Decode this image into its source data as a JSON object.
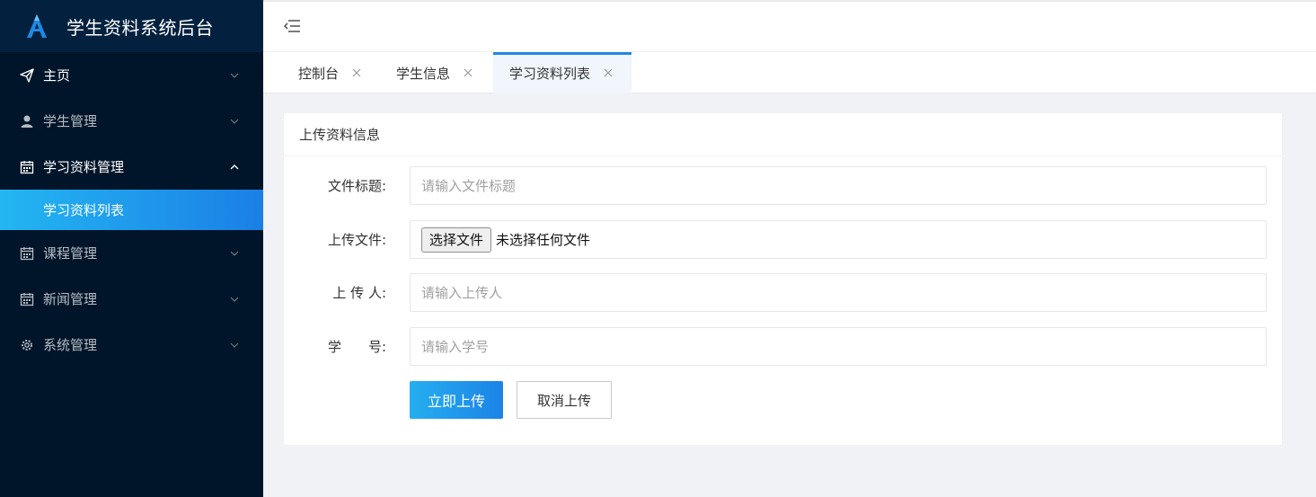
{
  "app": {
    "title": "学生资料系统后台"
  },
  "sidebar": {
    "items": [
      {
        "label": "主页",
        "icon": "send-icon",
        "expanded": false
      },
      {
        "label": "学生管理",
        "icon": "user-icon",
        "expanded": false
      },
      {
        "label": "学习资料管理",
        "icon": "calendar-icon",
        "expanded": true,
        "children": [
          {
            "label": "学习资料列表",
            "active": true
          }
        ]
      },
      {
        "label": "课程管理",
        "icon": "calendar-icon",
        "expanded": false
      },
      {
        "label": "新闻管理",
        "icon": "calendar-icon",
        "expanded": false
      },
      {
        "label": "系统管理",
        "icon": "gear-icon",
        "expanded": false
      }
    ]
  },
  "tabs": [
    {
      "label": "控制台",
      "active": false
    },
    {
      "label": "学生信息",
      "active": false
    },
    {
      "label": "学习资料列表",
      "active": true
    }
  ],
  "card": {
    "title": "上传资料信息",
    "fields": {
      "title": {
        "label": "文件标题:",
        "placeholder": "请输入文件标题",
        "value": ""
      },
      "file": {
        "label": "上传文件:",
        "button": "选择文件",
        "status": "未选择任何文件"
      },
      "uploader": {
        "label": "上 传 人:",
        "placeholder": "请输入上传人",
        "value": ""
      },
      "student_id": {
        "label": "学　　号:",
        "placeholder": "请输入学号",
        "value": ""
      }
    },
    "submit_label": "立即上传",
    "cancel_label": "取消上传"
  },
  "colors": {
    "sidebar_bg": "#001529",
    "logo_bg": "#03213f",
    "accent": "#1e88e5",
    "active_gradient_start": "#23b6f2",
    "active_gradient_end": "#1b7fe6"
  }
}
